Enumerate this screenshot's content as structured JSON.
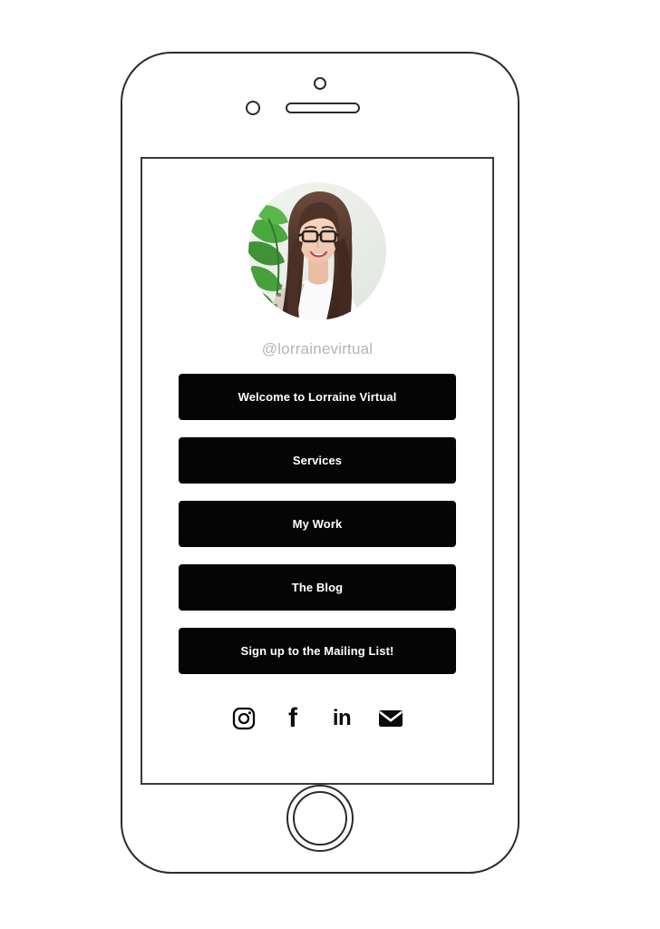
{
  "device": {
    "name": "smartphone-mockup",
    "frame_color": "#2b2b2b",
    "screen_border_color": "#3a3a3a",
    "background_color": "#ffffff",
    "hardware": {
      "front_camera": "front-camera-icon",
      "proximity_sensor": "proximity-sensor-icon",
      "earpiece_speaker": "earpiece-speaker",
      "home_button": "home-button"
    }
  },
  "screen": {
    "profile": {
      "avatar_alt": "portrait of woman with glasses and long dark hair beside a green plant",
      "handle": "@lorrainevirtual",
      "handle_color": "#b4b4b4"
    },
    "links": [
      {
        "label": "Welcome to Lorraine Virtual"
      },
      {
        "label": "Services"
      },
      {
        "label": "My Work"
      },
      {
        "label": "The Blog"
      },
      {
        "label": "Sign up to the Mailing List!"
      }
    ],
    "link_style": {
      "background": "#050505",
      "text_color": "#ffffff"
    },
    "social": [
      {
        "name": "instagram-icon",
        "label": "Instagram"
      },
      {
        "name": "facebook-icon",
        "label": "f"
      },
      {
        "name": "linkedin-icon",
        "label": "in"
      },
      {
        "name": "email-icon",
        "label": "Email"
      }
    ]
  }
}
